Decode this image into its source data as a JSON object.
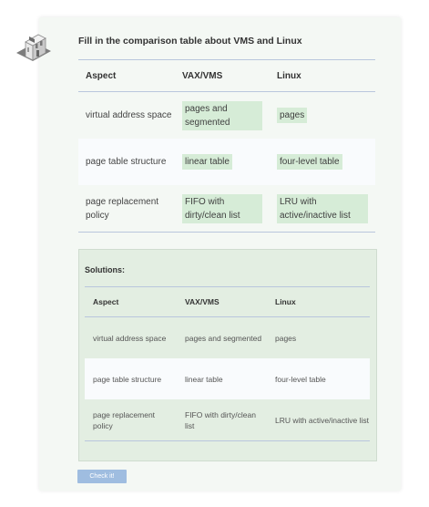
{
  "quiz": {
    "title": "Fill in the comparison table about VMS and Linux",
    "headers": [
      "Aspect",
      "VAX/VMS",
      "Linux"
    ],
    "rows": [
      {
        "aspect": "virtual address space",
        "vms": "pages and segmented",
        "linux": "pages"
      },
      {
        "aspect": "page table structure",
        "vms": "linear table",
        "linux": "four-level table"
      },
      {
        "aspect": "page replacement policy",
        "vms": "FIFO with dirty/clean list",
        "linux": "LRU with active/inactive list"
      }
    ]
  },
  "solutions": {
    "label": "Solutions:",
    "headers": [
      "Aspect",
      "VAX/VMS",
      "Linux"
    ],
    "rows": [
      {
        "aspect": "virtual address space",
        "vms": "pages and segmented",
        "linux": "pages"
      },
      {
        "aspect": "page table structure",
        "vms": "linear table",
        "linux": "four-level table"
      },
      {
        "aspect": "page replacement policy",
        "vms": "FIFO with dirty/clean list",
        "linux": "LRU with active/inactive list"
      }
    ]
  },
  "check_button": {
    "label": "Check it!"
  },
  "colors": {
    "answer_highlight": "#d6ecd7",
    "solution_box": "#e3eee2",
    "button": "#9fbde0"
  },
  "icons": {
    "logo": "building-logo-icon"
  }
}
